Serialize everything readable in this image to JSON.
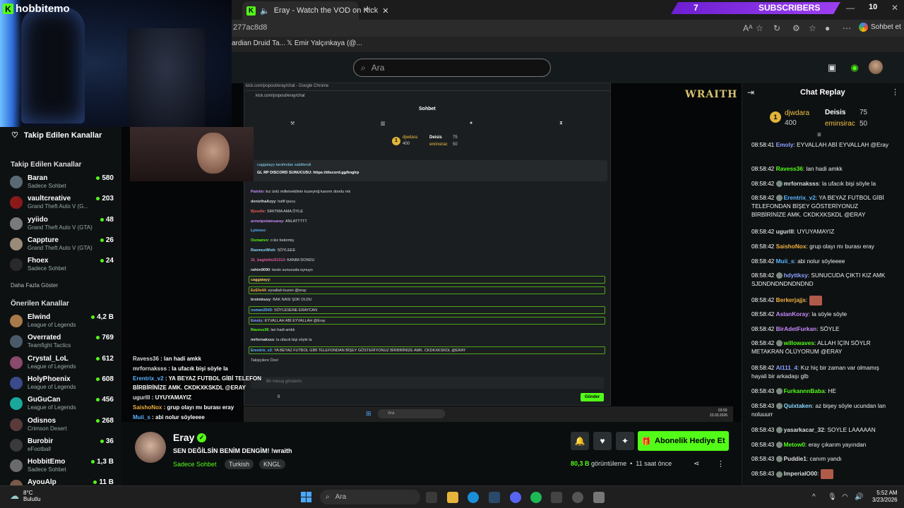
{
  "browser": {
    "tab_title": "Eray - Watch the VOD on Kick",
    "url_fragment": "277ac8d8",
    "profile_label": "Sohbet et",
    "bookmarks": [
      "ardian Druid Ta...",
      "Emir Yalçınkaya (@..."
    ],
    "notification_count": "10"
  },
  "overlay": {
    "brand": "hobbitemo",
    "subs_count": "7",
    "subs_label": "SUBSCRIBERS",
    "wraith_logo": "WRAITH"
  },
  "kick_header": {
    "search_placeholder": "Ara"
  },
  "sidebar": {
    "followed_title": "Takip Edilen Kanallar",
    "followed_section": "Takip Edilen Kanallar",
    "followed": [
      {
        "name": "Baran",
        "game": "Sadece Sohbet",
        "viewers": "580",
        "avatar": "#5a6a75"
      },
      {
        "name": "vaultcreative",
        "game": "Grand Theft Auto V (G...",
        "viewers": "203",
        "avatar": "#8a1a1a"
      },
      {
        "name": "yyiido",
        "game": "Grand Theft Auto V (GTA)",
        "viewers": "48",
        "avatar": "#7a7a7a"
      },
      {
        "name": "Cappture",
        "game": "Grand Theft Auto V (GTA)",
        "viewers": "26",
        "avatar": "#9a8a7a"
      },
      {
        "name": "Fhoex",
        "game": "Sadece Sohbet",
        "viewers": "24",
        "avatar": "#2a2a2a"
      }
    ],
    "show_more": "Daha Fazla Göster",
    "recommended_section": "Önerilen Kanallar",
    "recommended": [
      {
        "name": "Elwind",
        "game": "League of Legends",
        "viewers": "4,2 B",
        "avatar": "#a87a4a"
      },
      {
        "name": "Overrated",
        "game": "Teamfight Tactics",
        "viewers": "769",
        "avatar": "#4a5a6a"
      },
      {
        "name": "Crystal_LoL",
        "game": "League of Legends",
        "viewers": "612",
        "avatar": "#8a4a6a"
      },
      {
        "name": "HolyPhoenix",
        "game": "League of Legends",
        "viewers": "608",
        "avatar": "#3a4a8a"
      },
      {
        "name": "GuGuCan",
        "game": "League of Legends",
        "viewers": "456",
        "avatar": "#1aa89a"
      },
      {
        "name": "Odisnos",
        "game": "Crimson Desert",
        "viewers": "268",
        "avatar": "#5a3a3a"
      },
      {
        "name": "Burobir",
        "game": "eFootball",
        "viewers": "36",
        "avatar": "#3a3a3a"
      },
      {
        "name": "HobbitEmo",
        "game": "Sadece Sohbet",
        "viewers": "1,3 B",
        "avatar": "#6a6a6a"
      },
      {
        "name": "AyouAlp",
        "game": "",
        "viewers": "11 B",
        "avatar": "#7a5a4a"
      }
    ]
  },
  "popup": {
    "title_bar": "kick.com/popout/eray/chat - Google Chrome",
    "url": "kick.com/popout/eray/chat",
    "header": "Sohbet",
    "leader_top": "djwdara",
    "leader_top_val": "400",
    "leader_2": "Deisis",
    "leader_2_val": "75",
    "leader_3": "eminsirac",
    "leader_3_val": "50",
    "pinned_by": "caggatayy tarafından sabitlendi",
    "pinned_text": "GL RP DISCORD SUNUCUSU: https://discord.gg/knglrp",
    "lines": [
      {
        "u": "Paintio",
        "t": "kız ünlü milletvekilinin kuzeyinğ kanımı dondu mk",
        "c": "#c58af9"
      },
      {
        "u": "denizthaAzyy",
        "t": "hafif ipucu",
        "c": "#ddd"
      },
      {
        "u": "Bjoedle",
        "t": "SIRITMA AMA ÖYLE",
        "c": "#e45a5a"
      },
      {
        "u": "armutpotatesaray",
        "t": "ANLATTTTT",
        "c": "#c58af9"
      },
      {
        "u": "Lytveox",
        "t": "",
        "c": "#5ab4ff"
      },
      {
        "u": "Osmanvv",
        "t": "o kiz bekirmiş",
        "c": "#53fc18"
      },
      {
        "u": "RasmusWish",
        "t": "SÖYLEEE",
        "c": "#8ad9ff"
      },
      {
        "u": "31_bagimlisi31313",
        "t": "KANIM DONDU",
        "c": "#e45aa0"
      },
      {
        "u": "rahim9090",
        "t": "kesin sunucuda oynuyo",
        "c": "#ddd"
      },
      {
        "u": "caggatayy",
        "t": "",
        "c": "#f0d060"
      },
      {
        "u": "EeEfe44",
        "t": "eyvallah kuzen @eray",
        "c": "#f0b040"
      },
      {
        "u": "broimbusy",
        "t": "BAK NASI ŞOK OLDU",
        "c": "#ddd"
      },
      {
        "u": "osman2543",
        "t": "SÖYLESENE ERAYCAN",
        "c": "#5ab4ff"
      },
      {
        "u": "Emoly",
        "t": "EYVALLAH ABİ EYVALLAH @Eray",
        "c": "#8aa0ff"
      },
      {
        "u": "Ravess36",
        "t": "lan hadi amkk",
        "c": "#53fc18"
      },
      {
        "u": "mrfornaksss",
        "t": "la ufacık bişi söyle la",
        "c": "#ddd"
      },
      {
        "u": "Erentrix_v2",
        "t": "YA BEYAZ FUTBOL GİBİ TELEFONDAN BİŞEY GÖSTERİYONUZ BİRBİRİNİZE AMK. CKDKXKSKDL @ERAY",
        "c": "#5ab4ff"
      }
    ],
    "input_placeholder": "Bir mesaj gönderin",
    "send_label": "Gönder",
    "followers_only": "Takipçilere Özel",
    "counter": "0",
    "taskbar_search": "Ara",
    "taskbar_time": "03:59",
    "taskbar_date": "23.03.2026"
  },
  "stream_overlay_chat": [
    {
      "u": "Ravess36",
      "t": "lan hadi amkk",
      "c": "#ddd"
    },
    {
      "u": "mrfornaksss",
      "t": "la ufacık bişi söyle la",
      "c": "#ddd"
    },
    {
      "u": "Erentrix_v2",
      "t": "YA BEYAZ FUTBOL GİBİ TELEFON",
      "c": "#5ab4ff"
    },
    {
      "u": "",
      "t": "BİRBİRİNİZE AMK. CKDKXKSKDL @ERAY",
      "c": "#ddd"
    },
    {
      "u": "ugurlll",
      "t": "UYUYAMAYIZ",
      "c": "#ddd"
    },
    {
      "u": "SaishoNox",
      "t": "grup olayı mı burası eray",
      "c": "#f0b040"
    },
    {
      "u": "Muii_s",
      "t": "abi nolur söyleeee",
      "c": "#5ab4ff"
    }
  ],
  "channel": {
    "name": "Eray",
    "title": "SEN DEĞİLSİN BENİM DENGİM! !wraith",
    "category": "Sadece Sohbet",
    "tags": [
      "Turkish",
      "KNGL"
    ],
    "gift_button": "Abonelik Hediye Et",
    "views_count": "80,3 B",
    "views_label": "görüntüleme",
    "time_ago": "11 saat önce"
  },
  "chat_replay": {
    "title": "Chat Replay",
    "leader_top": "djwdara",
    "leader_top_val": "400",
    "leader_2": "Deisis",
    "leader_2_val": "75",
    "leader_3": "eminsirac",
    "leader_3_val": "50",
    "messages": [
      {
        "ts": "08:58:41",
        "u": "Emoly",
        "t": "EYVALLAH ABİ EYVALLAH @Eray",
        "c": "#8aa0ff"
      },
      {
        "ts": "08:58:42",
        "u": "Ravess36",
        "t": "lan hadi amkk",
        "c": "#53fc18"
      },
      {
        "ts": "08:58:42",
        "u": "mrfornaksss",
        "t": "la ufacık bişi söyle la",
        "c": "#ddd"
      },
      {
        "ts": "08:58:42",
        "u": "Erentrix_v2",
        "t": "YA BEYAZ FUTBOL GİBİ TELEFONDAN BİŞEY GÖSTERİYONUZ BİRBİRİNİZE AMK. CKDKXKSKDL @ERAY",
        "c": "#5ab4ff"
      },
      {
        "ts": "08:58:42",
        "u": "ugurlll",
        "t": "UYUYAMAYIZ",
        "c": "#ddd"
      },
      {
        "ts": "08:58:42",
        "u": "SaishoNox",
        "t": "grup olayı mı burası eray",
        "c": "#f0b040"
      },
      {
        "ts": "08:58:42",
        "u": "Muii_s",
        "t": "abi nolur söyleeee",
        "c": "#5ab4ff"
      },
      {
        "ts": "08:58:42",
        "u": "hdyttksy",
        "t": "SUNUCUDA ÇIKTI KIZ AMK SJDNDNDNDNDNDND",
        "c": "#8aa0ff"
      },
      {
        "ts": "08:58:42",
        "u": "Berkerjajjs",
        "t": "",
        "c": "#f0b040"
      },
      {
        "ts": "08:58:42",
        "u": "AslanKoray",
        "t": "la söyle söyle",
        "c": "#c58af9"
      },
      {
        "ts": "08:58:42",
        "u": "BirAdetFurkan",
        "t": "SÖYLE",
        "c": "#c58af9"
      },
      {
        "ts": "08:58:42",
        "u": "willowaves",
        "t": "ALLAH İÇİN SÖYLR METAKRAN ÖLÜYORUM @ERAY",
        "c": "#53fc18"
      },
      {
        "ts": "08:58:42",
        "u": "Al111_4",
        "t": "Kız hiç bir zaman var olmamış hayali bir arkadaşı glb",
        "c": "#8aa0ff"
      },
      {
        "ts": "08:58:43",
        "u": "FurkannnBaba",
        "t": "HE",
        "c": "#53fc18"
      },
      {
        "ts": "08:58:43",
        "u": "Quixtaken",
        "t": "az bişey söyle ucundan lan noluuurr",
        "c": "#8ad9ff"
      },
      {
        "ts": "08:58:43",
        "u": "yasarkacar_32",
        "t": "SOYLE LAAAAAN",
        "c": "#ddd"
      },
      {
        "ts": "08:58:43",
        "u": "Metow0",
        "t": "eray çıkarım yayından",
        "c": "#53fc18"
      },
      {
        "ts": "08:58:43",
        "u": "Puddie1",
        "t": "canım yandı",
        "c": "#ddd"
      },
      {
        "ts": "08:58:43",
        "u": "ImperialO00",
        "t": "",
        "c": "#ddd"
      }
    ]
  },
  "os_taskbar": {
    "temp": "8°C",
    "weather": "Bulutlu",
    "search": "Ara",
    "time": "5:52 AM",
    "date": "3/23/2026"
  }
}
